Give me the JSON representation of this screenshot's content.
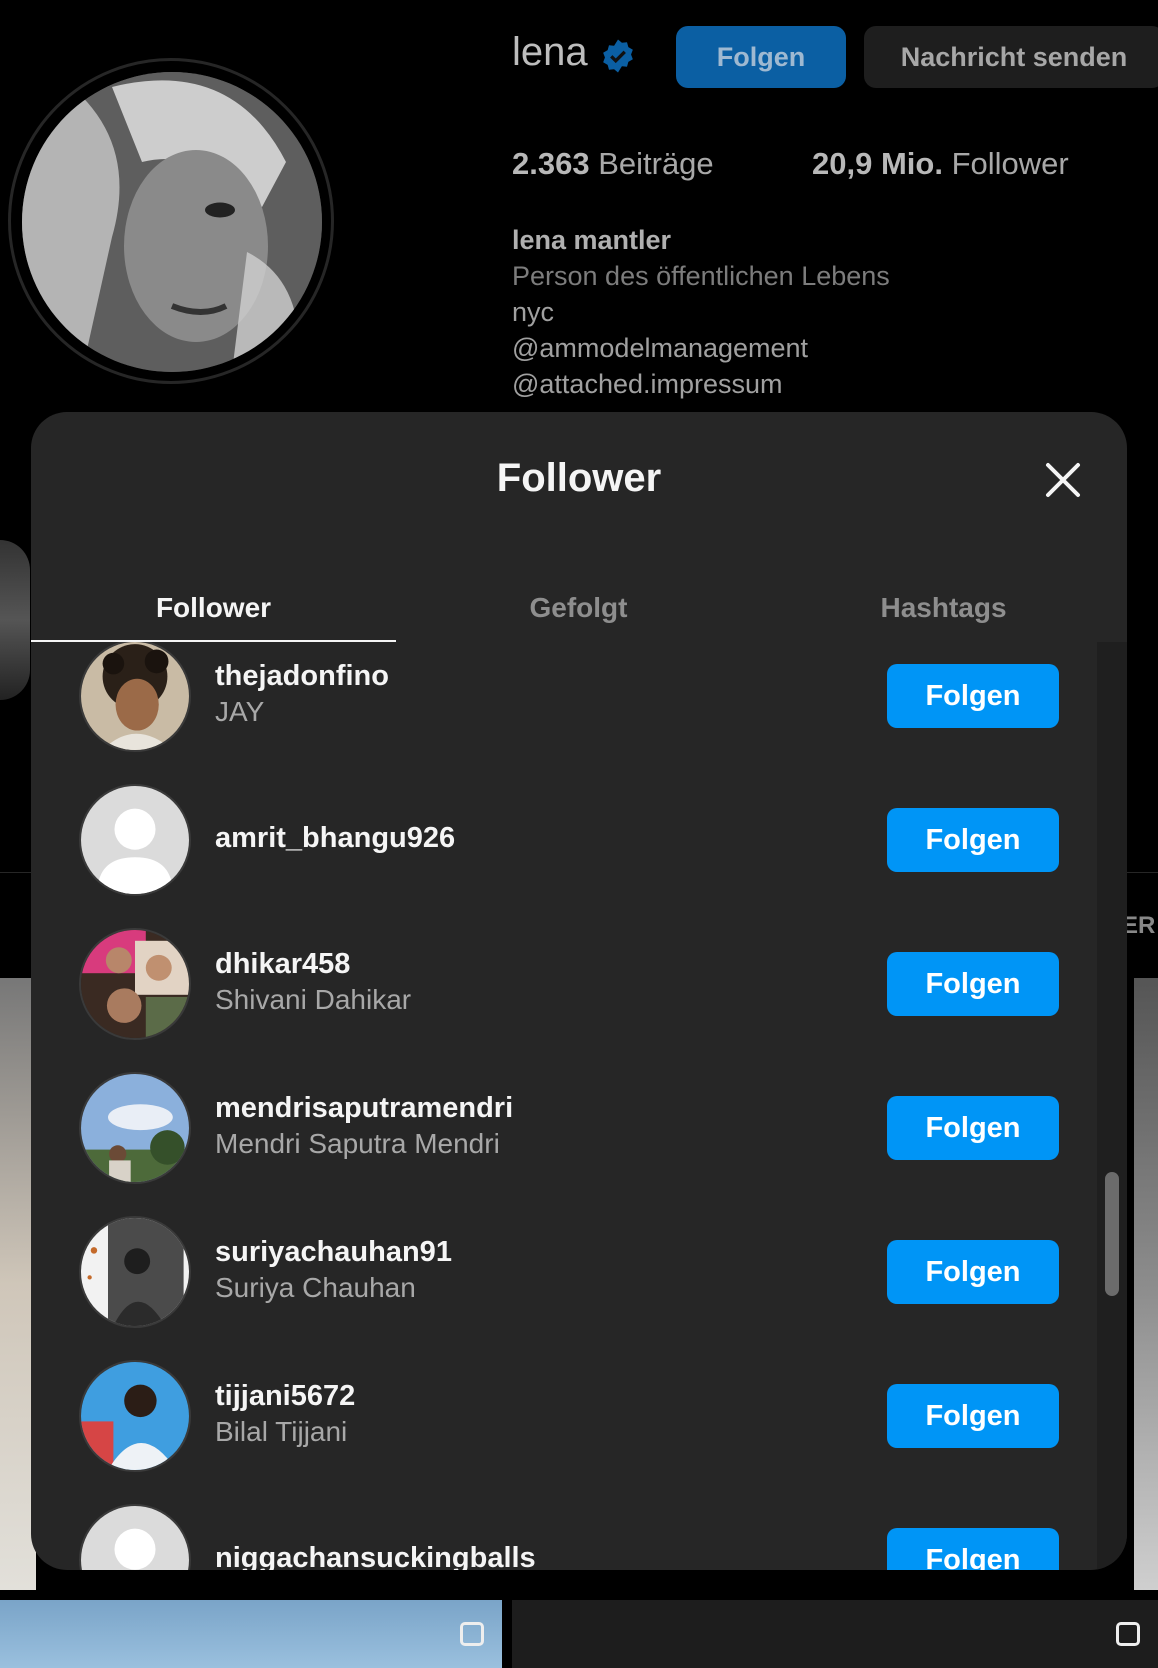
{
  "profile": {
    "username": "lena",
    "follow_label": "Folgen",
    "message_label": "Nachricht senden",
    "posts_count": "2.363",
    "posts_label": "Beiträge",
    "followers_count": "20,9 Mio.",
    "followers_label": "Follower",
    "bio": {
      "name": "lena mantler",
      "category": "Person des öffentlichen Lebens",
      "lines": [
        "nyc",
        "@ammodelmanagement",
        "@attached.impressum"
      ]
    },
    "tab_fragment": "ER"
  },
  "modal": {
    "title": "Follower",
    "tabs": [
      {
        "label": "Follower",
        "active": true
      },
      {
        "label": "Gefolgt",
        "active": false
      },
      {
        "label": "Hashtags",
        "active": false
      }
    ],
    "button_label": "Folgen",
    "followers": [
      {
        "handle": "thejadonfino",
        "name": "JAY",
        "avatar": "photo-curly-hair"
      },
      {
        "handle": "amrit_bhangu926",
        "name": "",
        "avatar": "default-avatar"
      },
      {
        "handle": "dhikar458",
        "name": "Shivani Dahikar",
        "avatar": "photo-collage"
      },
      {
        "handle": "mendrisaputramendri",
        "name": "Mendri Saputra Mendri",
        "avatar": "photo-sky"
      },
      {
        "handle": "suriyachauhan91",
        "name": "Suriya Chauhan",
        "avatar": "photo-bw"
      },
      {
        "handle": "tijjani5672",
        "name": "Bilal Tijjani",
        "avatar": "photo-blue"
      },
      {
        "handle": "niggachansuckingballs",
        "name": "",
        "avatar": "default-avatar"
      }
    ]
  },
  "colors": {
    "accent": "#0095f6",
    "modal_bg": "#262626",
    "page_bg": "#000000"
  }
}
